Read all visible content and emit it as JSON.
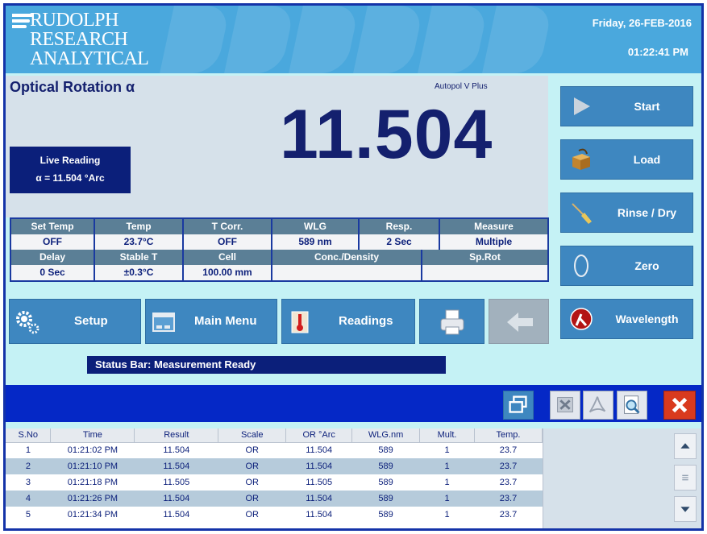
{
  "header": {
    "logo_lines": [
      "RUDOLPH",
      "RESEARCH",
      "ANALYTICAL"
    ],
    "date": "Friday, 26-FEB-2016",
    "time": "01:22:41 PM"
  },
  "reading": {
    "mode_title": "Optical Rotation α",
    "instrument": "Autopol V Plus",
    "value": "11.504",
    "live_label": "Live Reading",
    "live_value": "α = 11.504 °Arc"
  },
  "params": {
    "row1_headers": [
      "Set Temp",
      "Temp",
      "T Corr.",
      "WLG",
      "Resp.",
      "Measure"
    ],
    "row1_values": [
      "OFF",
      "23.7°C",
      "OFF",
      "589 nm",
      "2 Sec",
      "Multiple"
    ],
    "row2_headers": [
      "Delay",
      "Stable T",
      "Cell",
      "Conc./Density",
      "Sp.Rot"
    ],
    "row2_values": [
      "0 Sec",
      "±0.3°C",
      "100.00 mm",
      "",
      ""
    ]
  },
  "side_buttons": {
    "start": "Start",
    "load": "Load",
    "rinse": "Rinse / Dry",
    "zero": "Zero",
    "wavelength": "Wavelength"
  },
  "bottom_buttons": {
    "setup": "Setup",
    "main_menu": "Main Menu",
    "readings": "Readings"
  },
  "status_bar": "Status Bar: Measurement Ready",
  "table": {
    "columns": [
      "S.No",
      "Time",
      "Result",
      "Scale",
      "OR °Arc",
      "WLG.nm",
      "Mult.",
      "Temp."
    ],
    "rows": [
      [
        "1",
        "01:21:02 PM",
        "11.504",
        "OR",
        "11.504",
        "589",
        "1",
        "23.7"
      ],
      [
        "2",
        "01:21:10 PM",
        "11.504",
        "OR",
        "11.504",
        "589",
        "1",
        "23.7"
      ],
      [
        "3",
        "01:21:18 PM",
        "11.505",
        "OR",
        "11.505",
        "589",
        "1",
        "23.7"
      ],
      [
        "4",
        "01:21:26 PM",
        "11.504",
        "OR",
        "11.504",
        "589",
        "1",
        "23.7"
      ],
      [
        "5",
        "01:21:34 PM",
        "11.504",
        "OR",
        "11.504",
        "589",
        "1",
        "23.7"
      ]
    ]
  },
  "colors": {
    "header_bg": "#4aa8dd",
    "button_bg": "#3e87c0",
    "dark_navy": "#0b1f7a",
    "band_blue": "#0528c6",
    "background": "#c5f2f5"
  }
}
